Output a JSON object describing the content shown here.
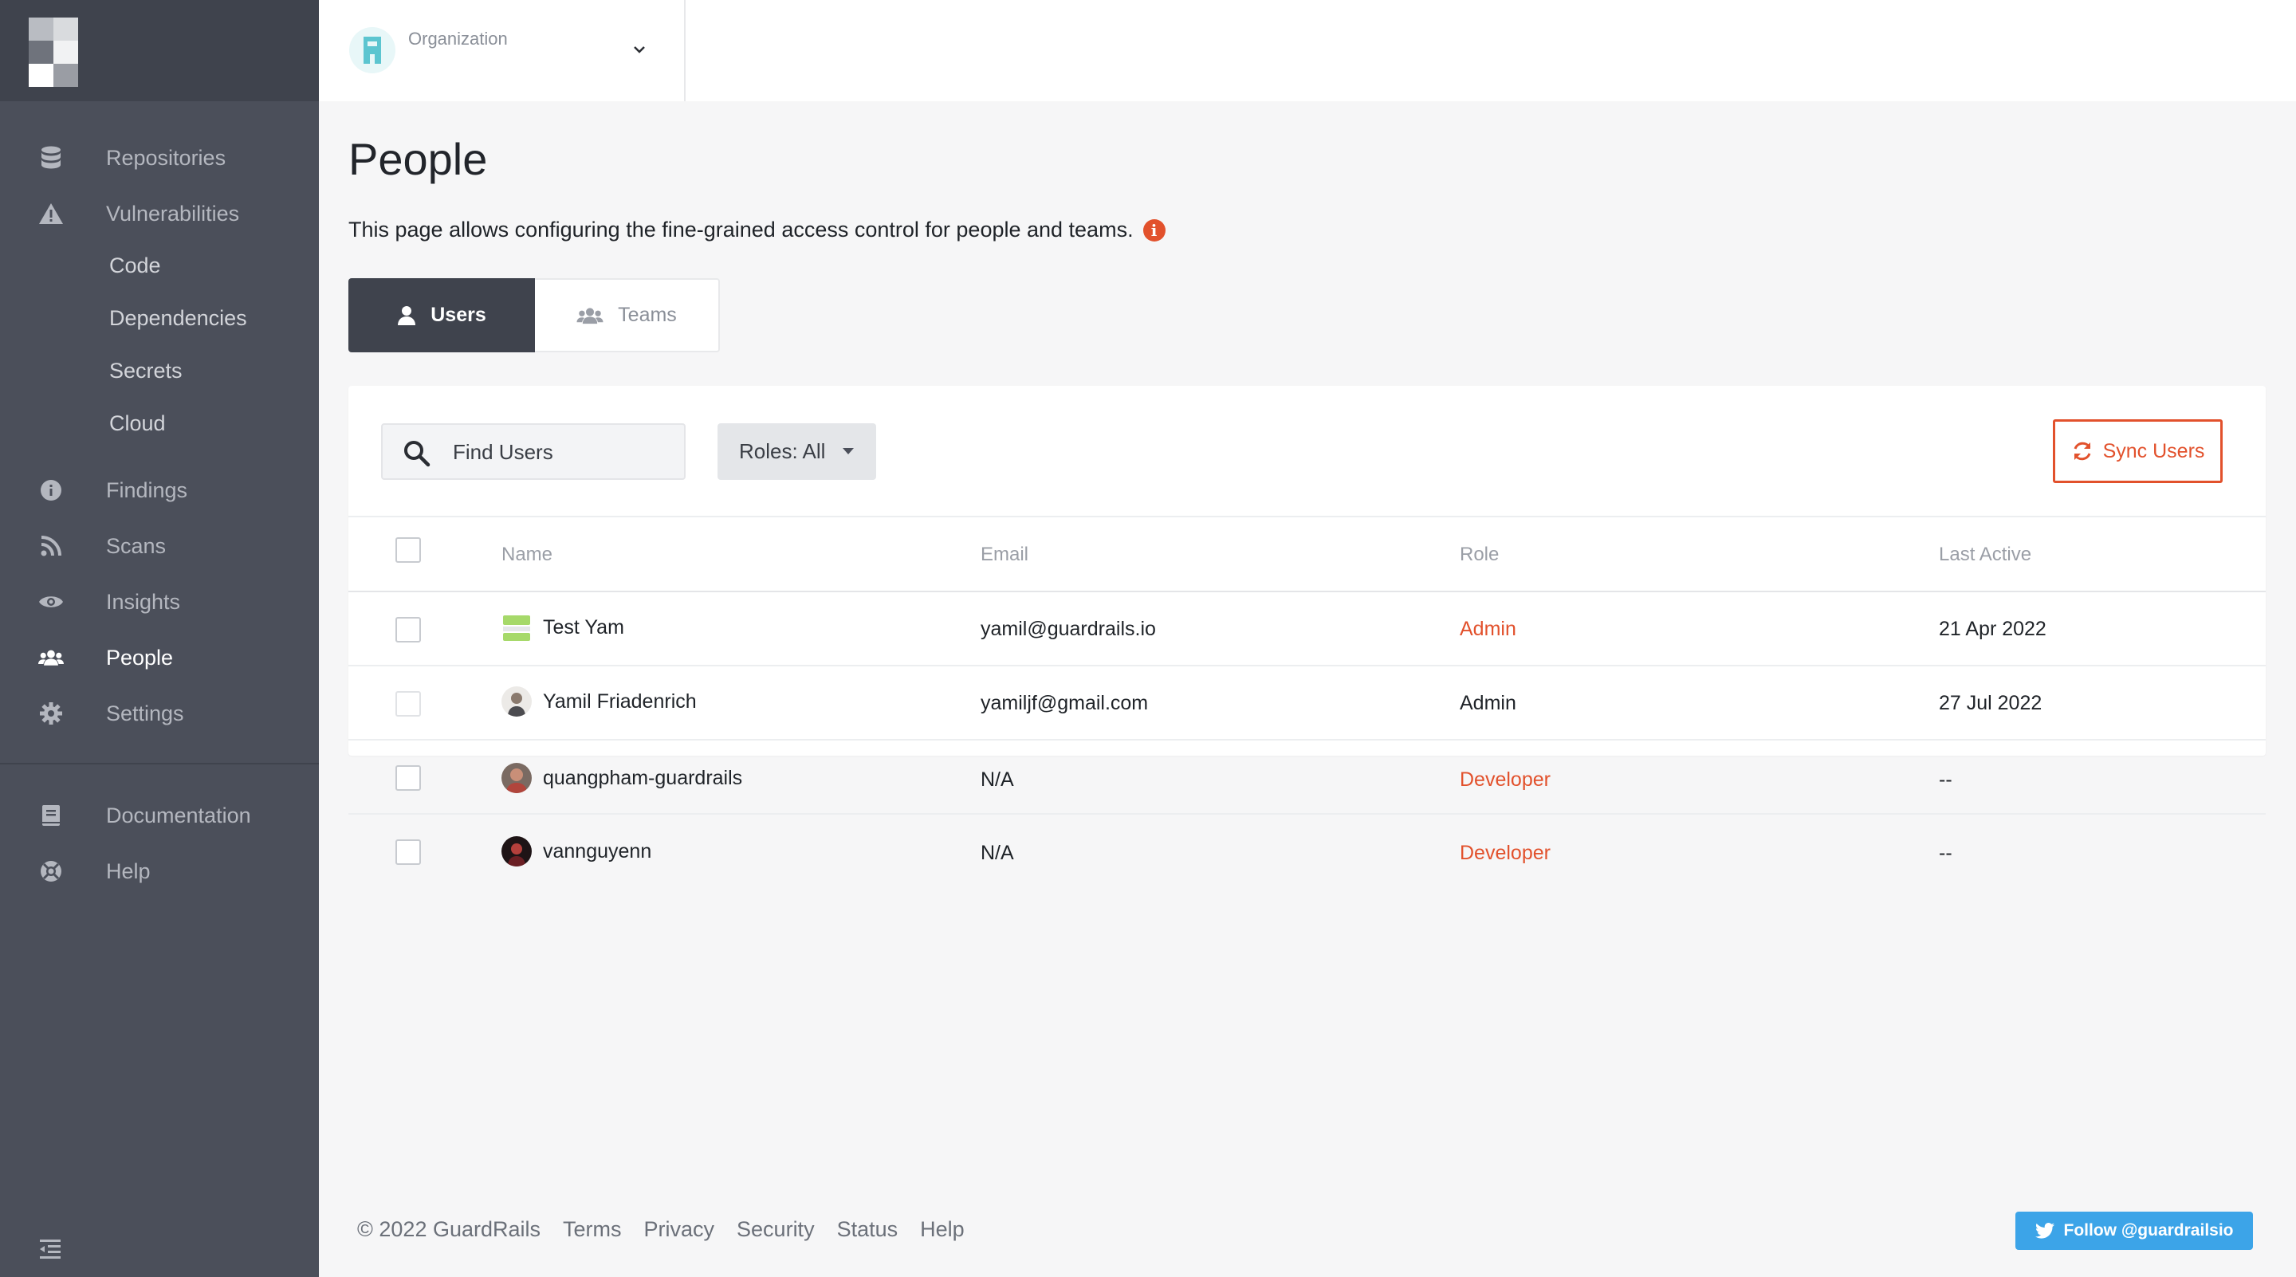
{
  "org": {
    "label": "Organization"
  },
  "sidebar": {
    "items": [
      {
        "label": "Repositories",
        "icon": "database-icon"
      },
      {
        "label": "Vulnerabilities",
        "icon": "warning-icon"
      },
      {
        "label": "Code",
        "sub": true
      },
      {
        "label": "Dependencies",
        "sub": true
      },
      {
        "label": "Secrets",
        "sub": true
      },
      {
        "label": "Cloud",
        "sub": true
      },
      {
        "label": "Findings",
        "icon": "info-icon"
      },
      {
        "label": "Scans",
        "icon": "rss-icon"
      },
      {
        "label": "Insights",
        "icon": "eye-icon"
      },
      {
        "label": "People",
        "icon": "users-icon",
        "active": true
      },
      {
        "label": "Settings",
        "icon": "gear-icon"
      },
      {
        "label": "Documentation",
        "icon": "book-icon"
      },
      {
        "label": "Help",
        "icon": "lifebuoy-icon"
      }
    ]
  },
  "page": {
    "title": "People",
    "description": "This page allows configuring the fine-grained access control for people and teams."
  },
  "tabs": {
    "users": "Users",
    "teams": "Teams"
  },
  "toolbar": {
    "search_placeholder": "Find Users",
    "roles_label": "Roles: All",
    "sync_label": "Sync Users"
  },
  "table": {
    "headers": {
      "name": "Name",
      "email": "Email",
      "role": "Role",
      "last_active": "Last Active"
    },
    "rows": [
      {
        "name": "Test Yam",
        "email": "yamil@guardrails.io",
        "role": "Admin",
        "last_active": "21 Apr 2022"
      },
      {
        "name": "Yamil Friadenrich",
        "email": "yamiljf@gmail.com",
        "role": "Admin",
        "last_active": "27 Jul 2022"
      },
      {
        "name": "quangpham-guardrails",
        "email": "N/A",
        "role": "Developer",
        "last_active": "--"
      },
      {
        "name": "vannguyenn",
        "email": "N/A",
        "role": "Developer",
        "last_active": "--"
      }
    ]
  },
  "footer": {
    "copyright": "© 2022 GuardRails",
    "links": [
      "Terms",
      "Privacy",
      "Security",
      "Status",
      "Help"
    ],
    "follow_label": "Follow @guardrailsio"
  },
  "colors": {
    "sidebar_bg": "#4b4f5a",
    "accent_orange": "#e2512c",
    "twitter_blue": "#3ca4e8"
  }
}
